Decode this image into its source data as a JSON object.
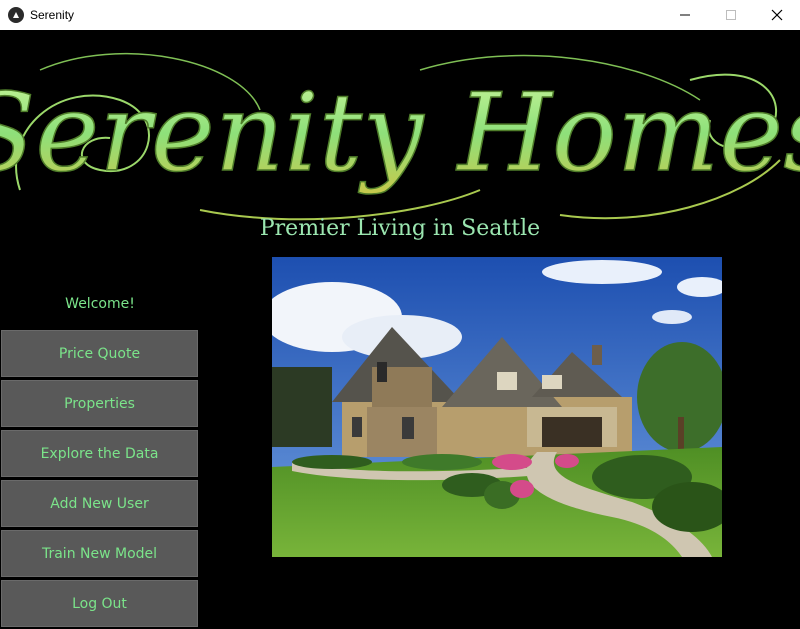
{
  "window": {
    "title": "Serenity"
  },
  "header": {
    "logo_text": "Serenity Homes",
    "subtitle": "Premier Living in Seattle"
  },
  "sidebar": {
    "welcome": "Welcome!",
    "items": [
      {
        "label": "Price Quote"
      },
      {
        "label": "Properties"
      },
      {
        "label": "Explore the Data"
      },
      {
        "label": "Add New User"
      },
      {
        "label": "Train New Model"
      },
      {
        "label": "Log Out"
      }
    ]
  },
  "colors": {
    "accent_text": "#7be48a",
    "button_bg": "#595959",
    "background": "#000000"
  },
  "icons": {
    "app": "kivy-logo-icon",
    "minimize": "minimize-icon",
    "maximize": "maximize-icon",
    "close": "close-icon"
  }
}
